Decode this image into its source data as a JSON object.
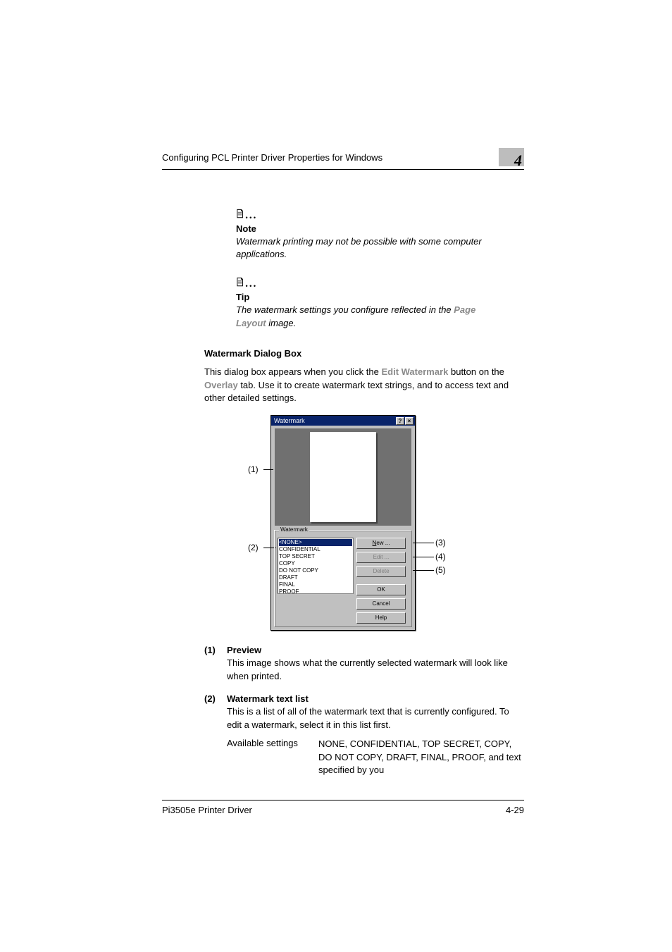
{
  "header": {
    "title": "Configuring PCL Printer Driver Properties for Windows",
    "chapter": "4"
  },
  "note": {
    "label": "Note",
    "body": "Watermark printing may not be possible with some computer applications."
  },
  "tip": {
    "label": "Tip",
    "body_prefix": "The watermark settings you configure reflected in the ",
    "body_link": "Page Layout",
    "body_suffix": " image."
  },
  "section": {
    "title": "Watermark Dialog Box",
    "body_prefix": "This dialog box appears when you click the ",
    "link1": "Edit Watermark",
    "mid1": " button on the ",
    "link2": "Overlay",
    "suffix": " tab. Use it to create watermark text strings, and to access text and other detailed settings."
  },
  "dialog": {
    "title": "Watermark",
    "help_glyph": "?",
    "close_glyph": "×",
    "groupbox_label": "Watermark",
    "list_items": [
      "<NONE>",
      "CONFIDENTIAL",
      "TOP SECRET",
      "COPY",
      "DO NOT COPY",
      "DRAFT",
      "FINAL",
      "PROOF"
    ],
    "btn_new": "New ...",
    "btn_edit": "Edit ...",
    "btn_delete": "Delete",
    "btn_ok": "OK",
    "btn_cancel": "Cancel",
    "btn_help": "Help"
  },
  "callouts": {
    "c1": "(1)",
    "c2": "(2)",
    "c3": "(3)",
    "c4": "(4)",
    "c5": "(5)"
  },
  "definitions": [
    {
      "num": "(1)",
      "title": "Preview",
      "body": "This image shows what the currently selected watermark will look like when printed."
    },
    {
      "num": "(2)",
      "title": "Watermark text list",
      "body": "This is a list of all of the watermark text that is currently configured. To edit a watermark, select it in this list first.",
      "avail_label": "Available settings",
      "avail_values": "NONE, CONFIDENTIAL, TOP SECRET, COPY, DO NOT COPY, DRAFT, FINAL, PROOF, and text specified by you"
    }
  ],
  "footer": {
    "left": "Pi3505e Printer Driver",
    "right": "4-29"
  }
}
